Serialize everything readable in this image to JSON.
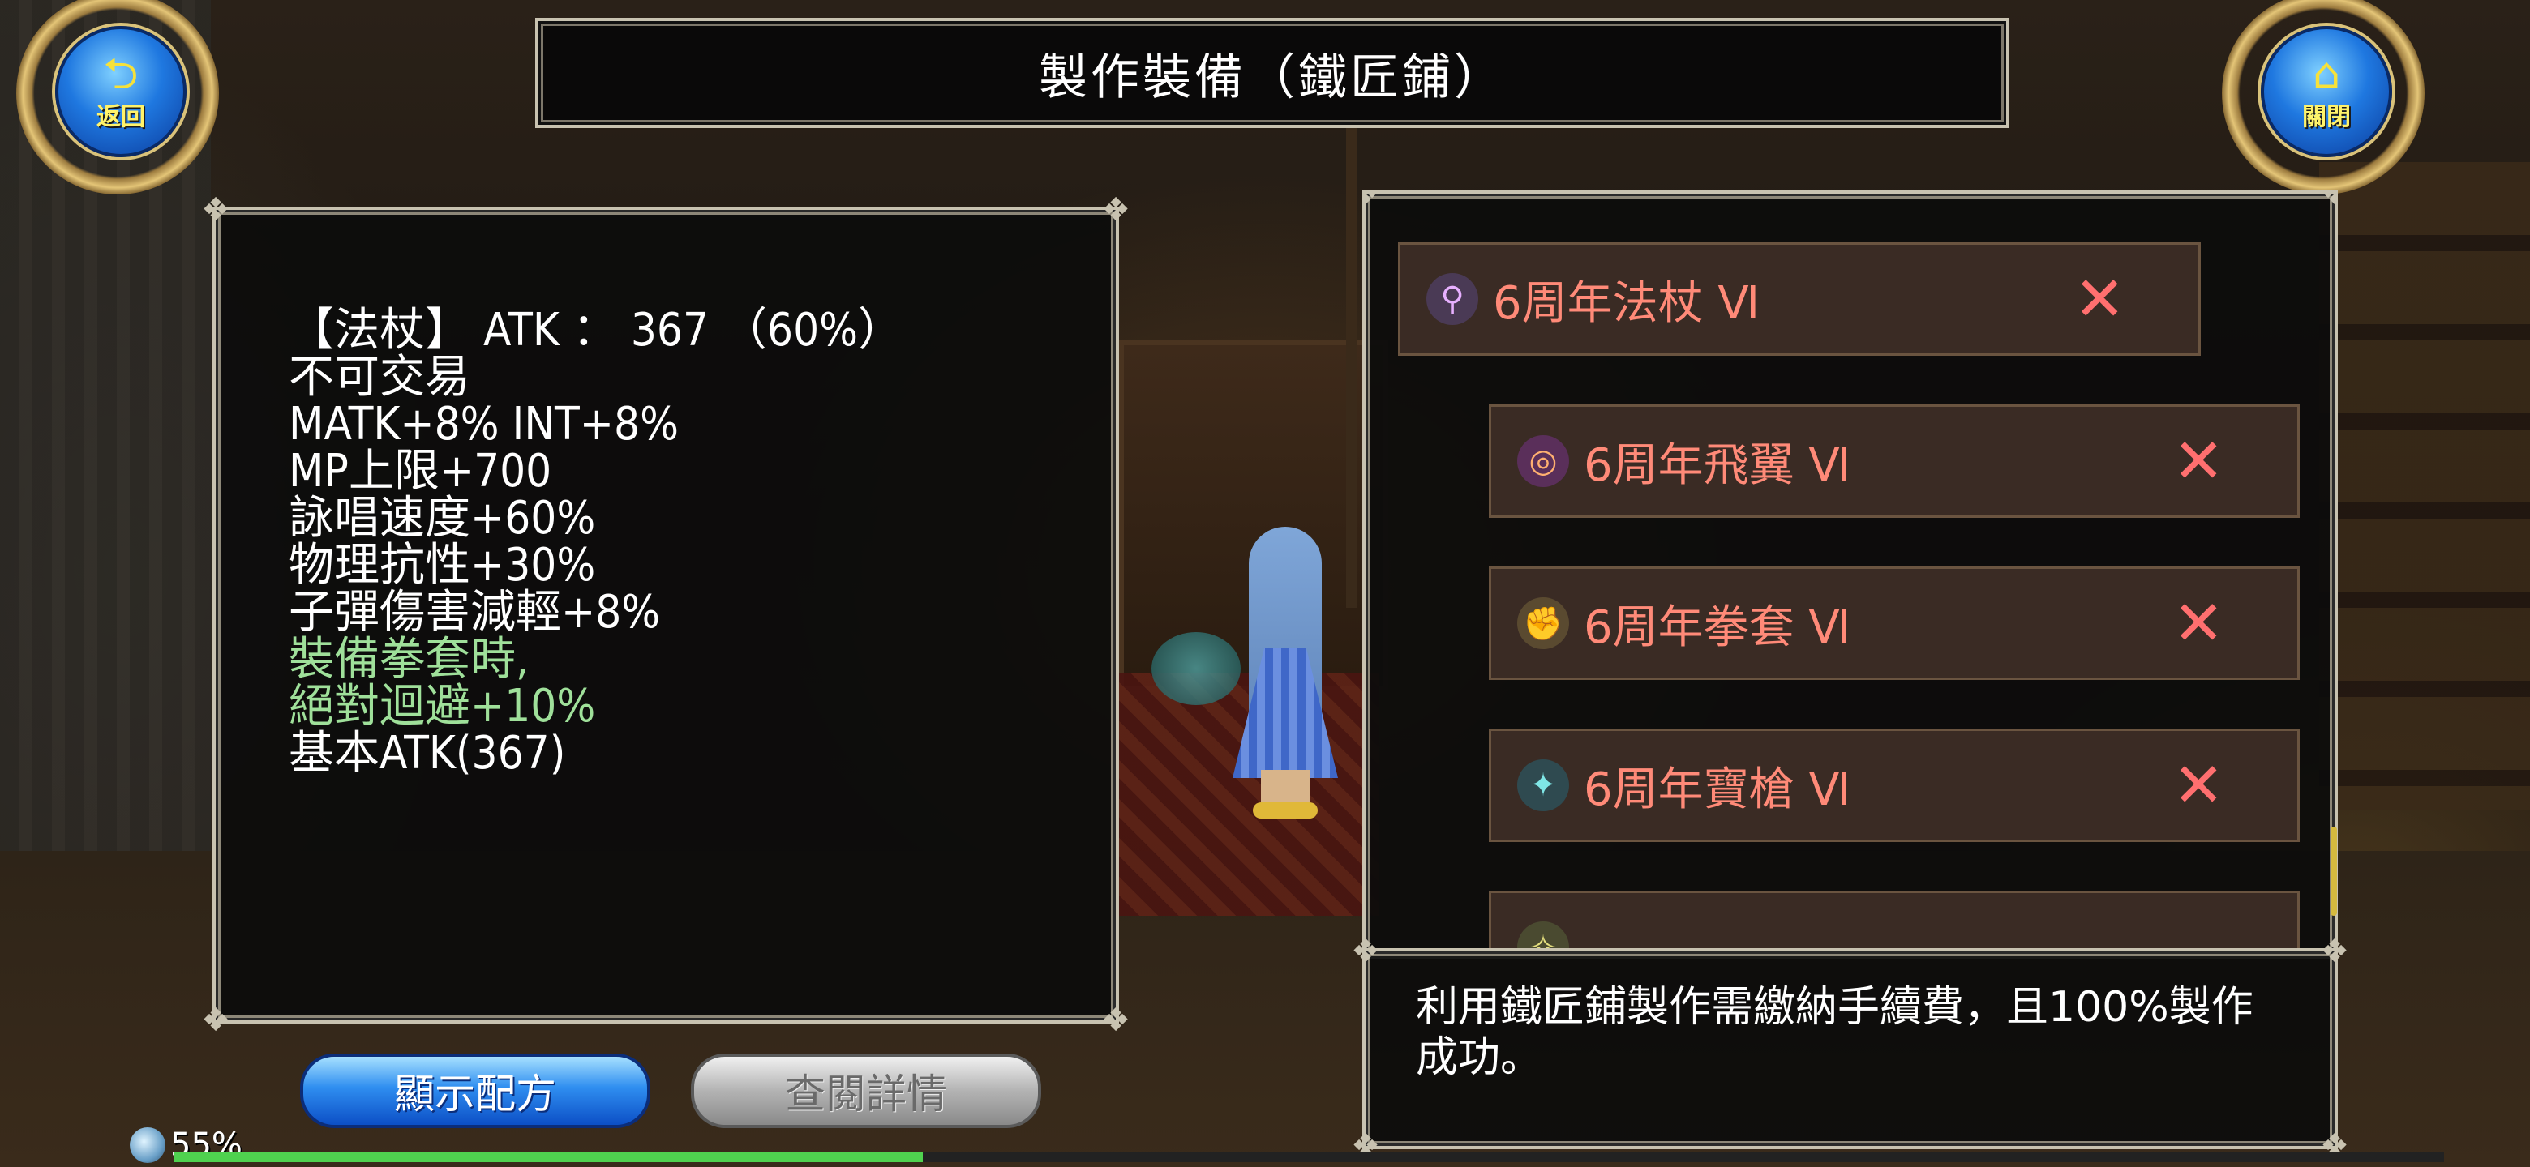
{
  "title": "製作裝備（鐵匠鋪）",
  "nav": {
    "back_label": "返回",
    "close_label": "關閉"
  },
  "item_info": {
    "lines": [
      "【法杖】 ATK ： 367 （60%）",
      "不可交易",
      "MATK+8% INT+8%",
      "MP上限+700",
      "詠唱速度+60%",
      "物理抗性+30%",
      "子彈傷害減輕+8%"
    ],
    "green_lines": [
      "裝備拳套時,",
      "絕對迴避+10%"
    ],
    "base_line": "基本ATK(367)"
  },
  "buttons": {
    "show_recipe": "顯示配方",
    "view_details": "查閱詳情"
  },
  "recipe_list": [
    {
      "name": "6周年法杖 Ⅵ",
      "icon": "staff-icon",
      "remove": "✕"
    },
    {
      "name": "6周年飛翼 Ⅵ",
      "icon": "wing-icon",
      "remove": "✕"
    },
    {
      "name": "6周年拳套 Ⅵ",
      "icon": "knuckle-icon",
      "remove": "✕"
    },
    {
      "name": "6周年寶槍 Ⅵ",
      "icon": "gun-icon",
      "remove": "✕"
    }
  ],
  "message": "利用鐵匠鋪製作需繳納手續費，且100%製作成功。",
  "status": {
    "percent_label": "55%",
    "exp_fraction": 0.33
  },
  "colors": {
    "item_name": "#ff8a78",
    "remove_x": "#ff6f6f",
    "green_text": "#9fe09a"
  }
}
